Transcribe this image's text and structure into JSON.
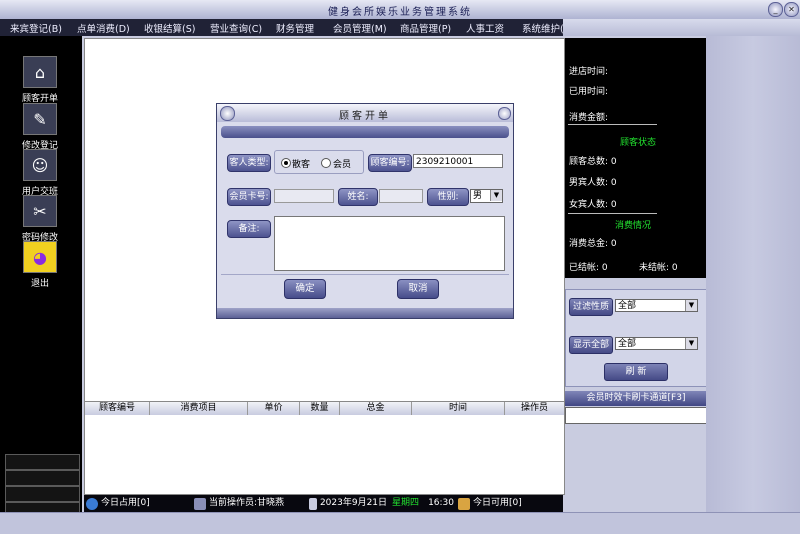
{
  "app": {
    "title": "健身会所娱乐业务管理系统",
    "min_glyph": "_",
    "close_glyph": "✕"
  },
  "menu": [
    "来宾登记(B)",
    "点单消费(D)",
    "收银结算(S)",
    "营业查询(C)",
    "财务管理",
    "会员管理(M)",
    "商品管理(P)",
    "人事工资",
    "系统维护(F)"
  ],
  "sidebar": [
    {
      "label": "顾客开单",
      "icon": "open-order-icon",
      "glyph": "⌂"
    },
    {
      "label": "修改登记",
      "icon": "edit-register-icon",
      "glyph": "✎"
    },
    {
      "label": "用户交班",
      "icon": "user-shift-icon",
      "glyph": "☺"
    },
    {
      "label": "密码修改",
      "icon": "password-tools-icon",
      "glyph": "✂"
    },
    {
      "label": "退出",
      "icon": "exit-icon",
      "glyph": "◕"
    }
  ],
  "dialog": {
    "title": "顾客开单",
    "guest_type_label": "客人类型:",
    "radio_regular": "散客",
    "radio_member": "会员",
    "guest_no_label": "顾客编号:",
    "guest_no_value": "2309210001",
    "member_card_label": "会员卡号:",
    "member_card_value": "",
    "name_label": "姓名:",
    "name_value": "",
    "gender_label": "性别:",
    "gender_value": "男",
    "remark_label": "备注:",
    "remark_value": "",
    "ok": "确定",
    "cancel": "取消"
  },
  "grid": {
    "columns": [
      "顾客编号",
      "消费项目",
      "单价",
      "数量",
      "总金",
      "时间",
      "操作员"
    ]
  },
  "status": {
    "occupied": "今日占用[0]",
    "operator": "当前操作员:甘晓燕",
    "date": "2023年9月21日",
    "weekday": "星期四",
    "time": "16:30",
    "available": "今日可用[0]"
  },
  "right": {
    "arrive_time": "进店时间:",
    "used_time": "已用时间:",
    "amount": "消费金额:",
    "guest_status_title": "顾客状态",
    "total_guests": "顾客总数: 0",
    "male_guests": "男宾人数: 0",
    "female_guests": "女宾人数: 0",
    "consume_title": "消费情况",
    "consume_total": "消费总金: 0",
    "settled": "已结帐: 0",
    "unsettled": "未结帐: 0"
  },
  "filter": {
    "filter_gender": "过滤性质",
    "filter_value": "全部",
    "show_all": "显示全部",
    "show_value": "全部",
    "refresh": "刷 新",
    "card_channel": "会员时效卡刷卡通道[F3]",
    "card_value": ""
  },
  "colors": {
    "menu_bg": "#202236",
    "panel_bg": "#000000",
    "accent_green": "#22e32f",
    "button_blue": "#464c8a"
  }
}
